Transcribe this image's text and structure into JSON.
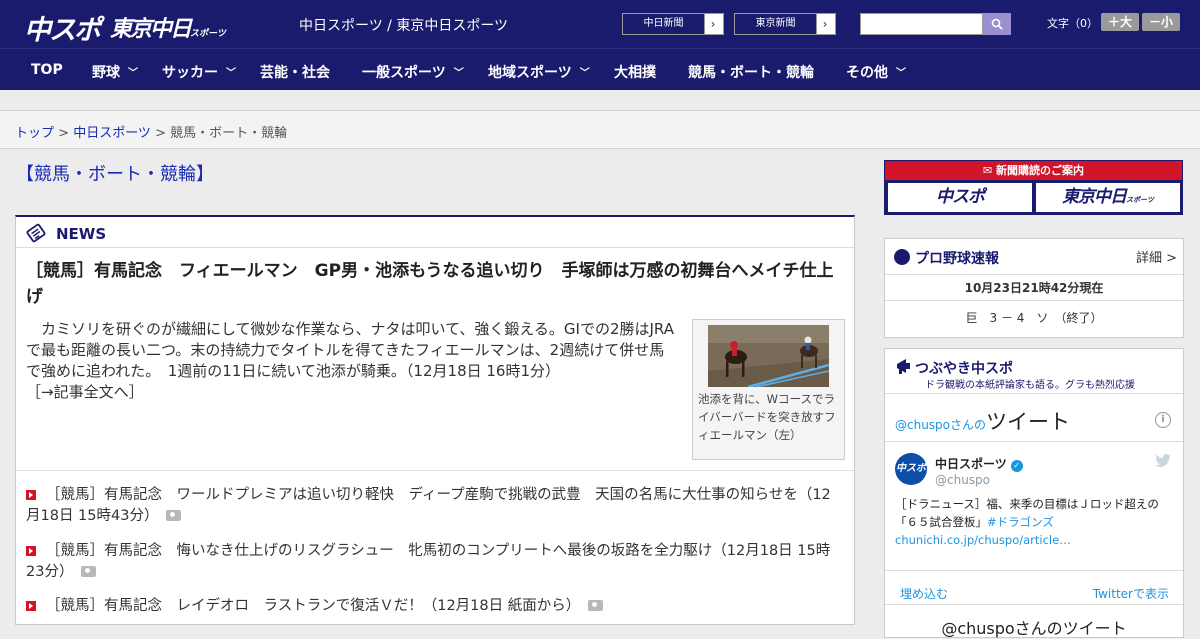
{
  "header": {
    "logo_main": "中スポ",
    "logo_tokyo": "東京中日",
    "logo_tokyo_small": "スポーツ",
    "site_title": "中日スポーツ / 東京中日スポーツ",
    "paper_links": [
      "中日新聞",
      "東京新聞"
    ],
    "search_placeholder": "",
    "font_label": "文字（0）",
    "font_bigger": "＋大",
    "font_smaller": "－小"
  },
  "nav": {
    "items": [
      {
        "label": "TOP"
      },
      {
        "label": "野球"
      },
      {
        "label": "サッカー"
      },
      {
        "label": "芸能・社会"
      },
      {
        "label": "一般スポーツ"
      },
      {
        "label": "地域スポーツ"
      },
      {
        "label": "大相撲"
      },
      {
        "label": "競馬・ボート・競輪"
      },
      {
        "label": "その他"
      }
    ]
  },
  "breadcrumb": {
    "top": "トップ",
    "sep": " > ",
    "parent": "中日スポーツ",
    "current": "競馬・ボート・競輪"
  },
  "section_title": "【競馬・ボート・競輪】",
  "news": {
    "label": "NEWS",
    "headline": "［競馬］有馬記念　フィエールマン　GP男・池添もうなる追い切り　手塚師は万感の初舞台へメイチ仕上げ",
    "lead": "　カミソリを研ぐのが繊細にして微妙な作業なら、ナタは叩いて、強く鍛える。GIでの2勝はJRAで最も距離の長い二つ。末の持続力でタイトルを得てきたフィエールマンは、2週続けて併せ馬で強めに追われた。　1週前の11日に続いて池添が騎乗。（12月18日 16時1分）",
    "more": "［→記事全文へ］",
    "photo_caption": "池添を背に、Wコースでライバーバードを突き放すフィエールマン（左）",
    "items": [
      {
        "text": "［競馬］有馬記念　ワールドプレミアは追い切り軽快　ディープ産駒で挑戦の武豊　天国の名馬に大仕事の知らせを",
        "time": "（12月18日 15時43分）"
      },
      {
        "text": "［競馬］有馬記念　悔いなき仕上げのリスグラシュー　牝馬初のコンプリートへ最後の坂路を全力駆け",
        "time": "（12月18日 15時23分）"
      },
      {
        "text": "［競馬］有馬記念　レイデオロ　ラストランで復活Ｖだ！",
        "time": "（12月18日 紙面から）"
      }
    ]
  },
  "subscribe": {
    "banner": "新聞購読のご案内",
    "logo_left": "中スポ",
    "logo_right": "東京中日",
    "logo_right_small": "スポーツ"
  },
  "pro_baseball": {
    "title": "プロ野球速報",
    "detail": "詳細 >",
    "time": "10月23日21時42分現在",
    "score": "巨　3 － 4　ソ　（終了）"
  },
  "tweets": {
    "title": "つぶやき中スポ",
    "subtitle": "ドラ観戦の本紙評論家も語る。グラも熱烈応援",
    "heading_handle": "@chuspoさんの",
    "heading_big": "ツイート",
    "info": "i",
    "avatar_text": "中スポ",
    "name": "中日スポーツ",
    "verified": "✓",
    "handle": "@chuspo",
    "text": "［ドラニュース］福、来季の目標はＪロッド超えの「６５試合登板」",
    "hashtag": "#ドラゴンズ",
    "link": "chunichi.co.jp/chuspo/article…",
    "embed": "埋め込む",
    "view_on_twitter": "Twitterで表示",
    "footer": "@chuspoさんのツイート"
  }
}
